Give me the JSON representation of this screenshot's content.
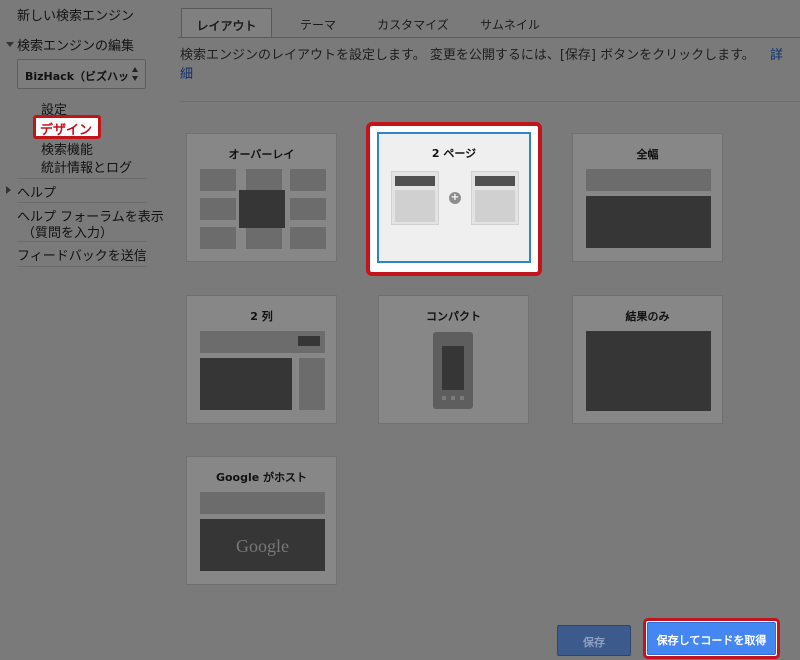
{
  "sidebar": {
    "new_engine": "新しい検索エンジン",
    "edit_engine": "検索エンジンの編集",
    "engine_select_value": "BizHack（ビズハッ",
    "settings": "設定",
    "design": "デザイン",
    "search_features": "検索機能",
    "stats_logs": "統計情報とログ",
    "help": "ヘルプ",
    "help_forum": "ヘルプ フォーラムを表示（質問を入力）",
    "help_forum_line1": "ヘルプ フォーラムを表示",
    "help_forum_line2": "（質問を入力）",
    "send_feedback": "フィードバックを送信"
  },
  "tabs": [
    {
      "label": "レイアウト",
      "active": true
    },
    {
      "label": "テーマ",
      "active": false
    },
    {
      "label": "カスタマイズ",
      "active": false
    },
    {
      "label": "サムネイル",
      "active": false
    }
  ],
  "description": {
    "text": "検索エンジンのレイアウトを設定します。 変更を公開するには、[保存] ボタンをクリックします。",
    "link_line1": "詳",
    "link_line2": "細"
  },
  "layouts": [
    {
      "label": "オーバーレイ",
      "selected": false
    },
    {
      "label": "2 ページ",
      "selected": true
    },
    {
      "label": "全幅",
      "selected": false
    },
    {
      "label": "2 列",
      "selected": false
    },
    {
      "label": "コンパクト",
      "selected": false
    },
    {
      "label": "結果のみ",
      "selected": false
    },
    {
      "label": "Google がホスト",
      "selected": false,
      "logo": "Google"
    }
  ],
  "buttons": {
    "save": "保存",
    "save_get_code": "保存してコードを取得"
  },
  "colors": {
    "highlight_red": "#c4141b",
    "selected_border": "#2a86c8",
    "primary_button": "#4486f2"
  }
}
